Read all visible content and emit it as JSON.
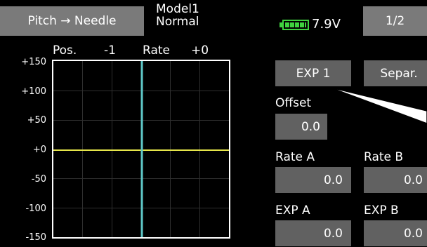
{
  "header": {
    "function_name": "Pitch → Needle",
    "model_name": "Model1",
    "condition": "Normal",
    "voltage": "7.9V",
    "battery_level": 1.0,
    "page": "1/2"
  },
  "graph": {
    "pos_label": "Pos.",
    "pos_value": "-1",
    "rate_label": "Rate",
    "rate_value": "+0",
    "y_ticks": [
      "+150",
      "+100",
      "+50",
      "+0",
      "-50",
      "-100",
      "-150"
    ]
  },
  "controls": {
    "exp_button": "EXP 1",
    "separate_button": "Separ.",
    "offset_label": "Offset",
    "offset_value": "0.0",
    "rate_a_label": "Rate A",
    "rate_a_value": "0.0",
    "rate_b_label": "Rate B",
    "rate_b_value": "0.0",
    "exp_a_label": "EXP A",
    "exp_a_value": "0.0",
    "exp_b_label": "EXP B",
    "exp_b_value": "0.0"
  },
  "colors": {
    "header_button": "#7a7a7a",
    "value_button": "#616161",
    "battery": "#3fd23f",
    "curve_line": "#e6e64a",
    "cursor_line": "#5fc8c8"
  }
}
